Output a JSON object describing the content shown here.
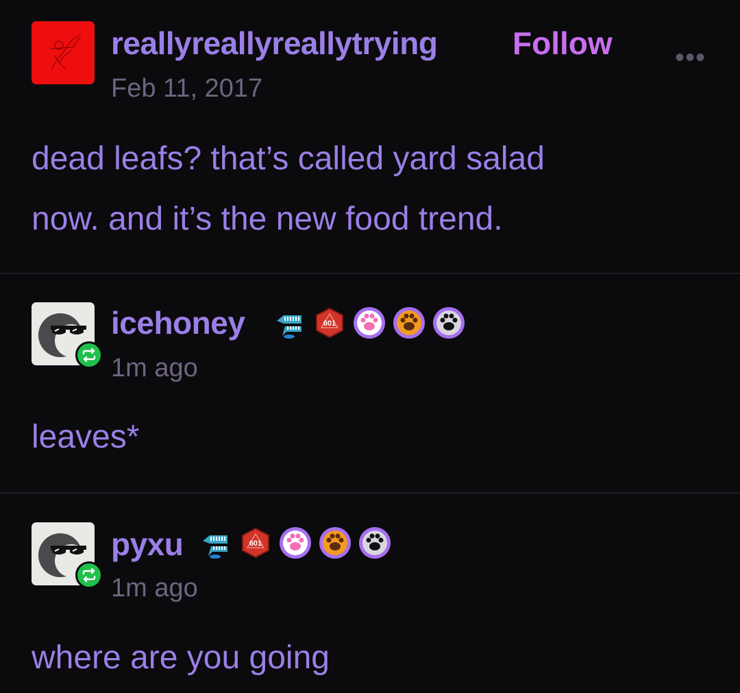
{
  "posts": [
    {
      "username": "reallyreallyreallytrying",
      "follow_label": "Follow",
      "more_label": "•••",
      "timestamp": "Feb 11, 2017",
      "body_lines": [
        "dead leafs? that’s called yard salad",
        "now. and it’s the new food trend."
      ]
    },
    {
      "username": "icehoney",
      "timestamp": "1m ago",
      "body": "leaves*",
      "badge_text": "601"
    },
    {
      "username": "pyxu",
      "timestamp": "1m ago",
      "body": "where are you going",
      "badge_text": "601"
    }
  ],
  "colors": {
    "background": "#0b0a0d",
    "text_purple": "#9b7fe6",
    "follow_pink": "#c86ef0",
    "muted": "#6e6580",
    "reblog_green": "#1fc04b",
    "avatar_red": "#ee0e0e"
  },
  "icons": [
    "reblog-icon",
    "teeth-badge-icon",
    "d20-badge-icon",
    "pink-paw-icon",
    "orange-paw-icon",
    "black-paw-icon",
    "more-icon"
  ]
}
